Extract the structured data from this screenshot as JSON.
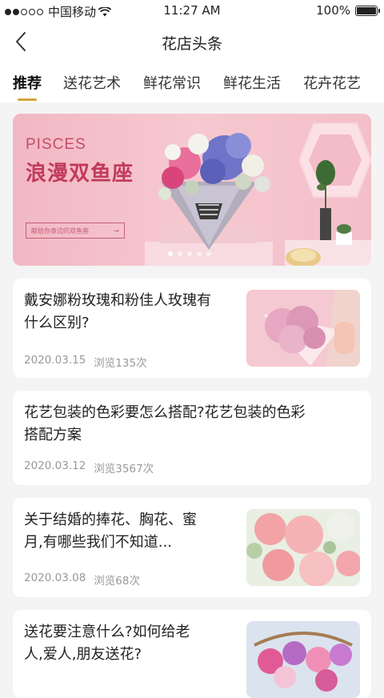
{
  "status_bar": {
    "carrier": "中国移动",
    "time": "11:27 AM",
    "battery": "100%"
  },
  "nav": {
    "title": "花店头条"
  },
  "tabs": [
    {
      "label": "推荐",
      "active": true
    },
    {
      "label": "送花艺术",
      "active": false
    },
    {
      "label": "鲜花常识",
      "active": false
    },
    {
      "label": "鲜花生活",
      "active": false
    },
    {
      "label": "花卉花艺",
      "active": false
    }
  ],
  "banner": {
    "en_title": "PISCES",
    "title": "浪漫双鱼座",
    "subtitle": "献给你身边的双鱼座",
    "slide_count": 5,
    "active_slide": 0
  },
  "articles": [
    {
      "title_line1": "戴安娜粉玫瑰和粉佳人玫瑰有",
      "title_line2": "什么区别?",
      "date": "2020.03.15",
      "views": "浏览135次",
      "has_image": true
    },
    {
      "title_line1": "花艺包装的色彩要怎么搭配?花艺包装的色彩",
      "title_line2": "搭配方案",
      "date": "2020.03.12",
      "views": "浏览3567次",
      "has_image": false
    },
    {
      "title_line1": "关于结婚的捧花、胸花、蜜",
      "title_line2": "月,有哪些我们不知道...",
      "date": "2020.03.08",
      "views": "浏览68次",
      "has_image": true
    },
    {
      "title_line1": "送花要注意什么?如何给老",
      "title_line2": "人,爱人,朋友送花?",
      "date": "",
      "views": "",
      "has_image": true
    }
  ]
}
